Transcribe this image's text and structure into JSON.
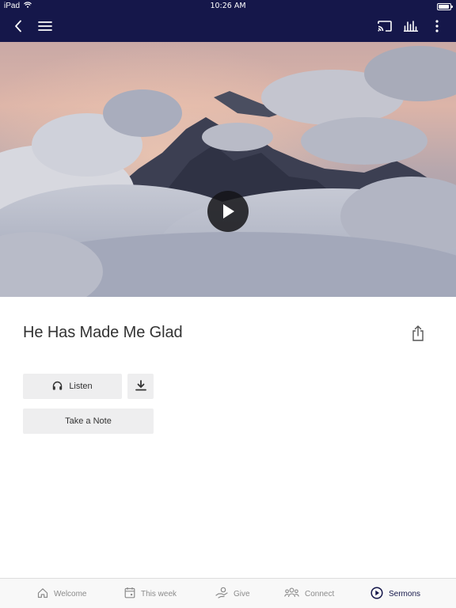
{
  "status_bar": {
    "device": "iPad",
    "time": "10:26 AM",
    "battery_level": 0.9,
    "wifi_icon": "wifi-icon",
    "battery_icon": "battery-icon"
  },
  "top_bar": {
    "background": "#15174a",
    "icons": [
      "back-chevron-icon",
      "hamburger-menu-icon",
      "cast-icon",
      "equalizer-icon",
      "more-vertical-icon"
    ]
  },
  "hero": {
    "play_icon": "play-icon"
  },
  "content": {
    "title": "He Has Made Me Glad",
    "share_icon": "share-icon",
    "listen_label": "Listen",
    "listen_icon": "headphones-icon",
    "download_icon": "download-icon",
    "note_label": "Take a Note"
  },
  "tab_bar": {
    "active_color": "#15174a",
    "inactive_color": "#8b8b8b",
    "tabs": [
      {
        "label": "Welcome",
        "icon": "home-icon"
      },
      {
        "label": "This week",
        "icon": "calendar-icon"
      },
      {
        "label": "Give",
        "icon": "give-hand-icon"
      },
      {
        "label": "Connect",
        "icon": "people-icon"
      },
      {
        "label": "Sermons",
        "icon": "play-circle-icon",
        "active": true
      }
    ]
  }
}
